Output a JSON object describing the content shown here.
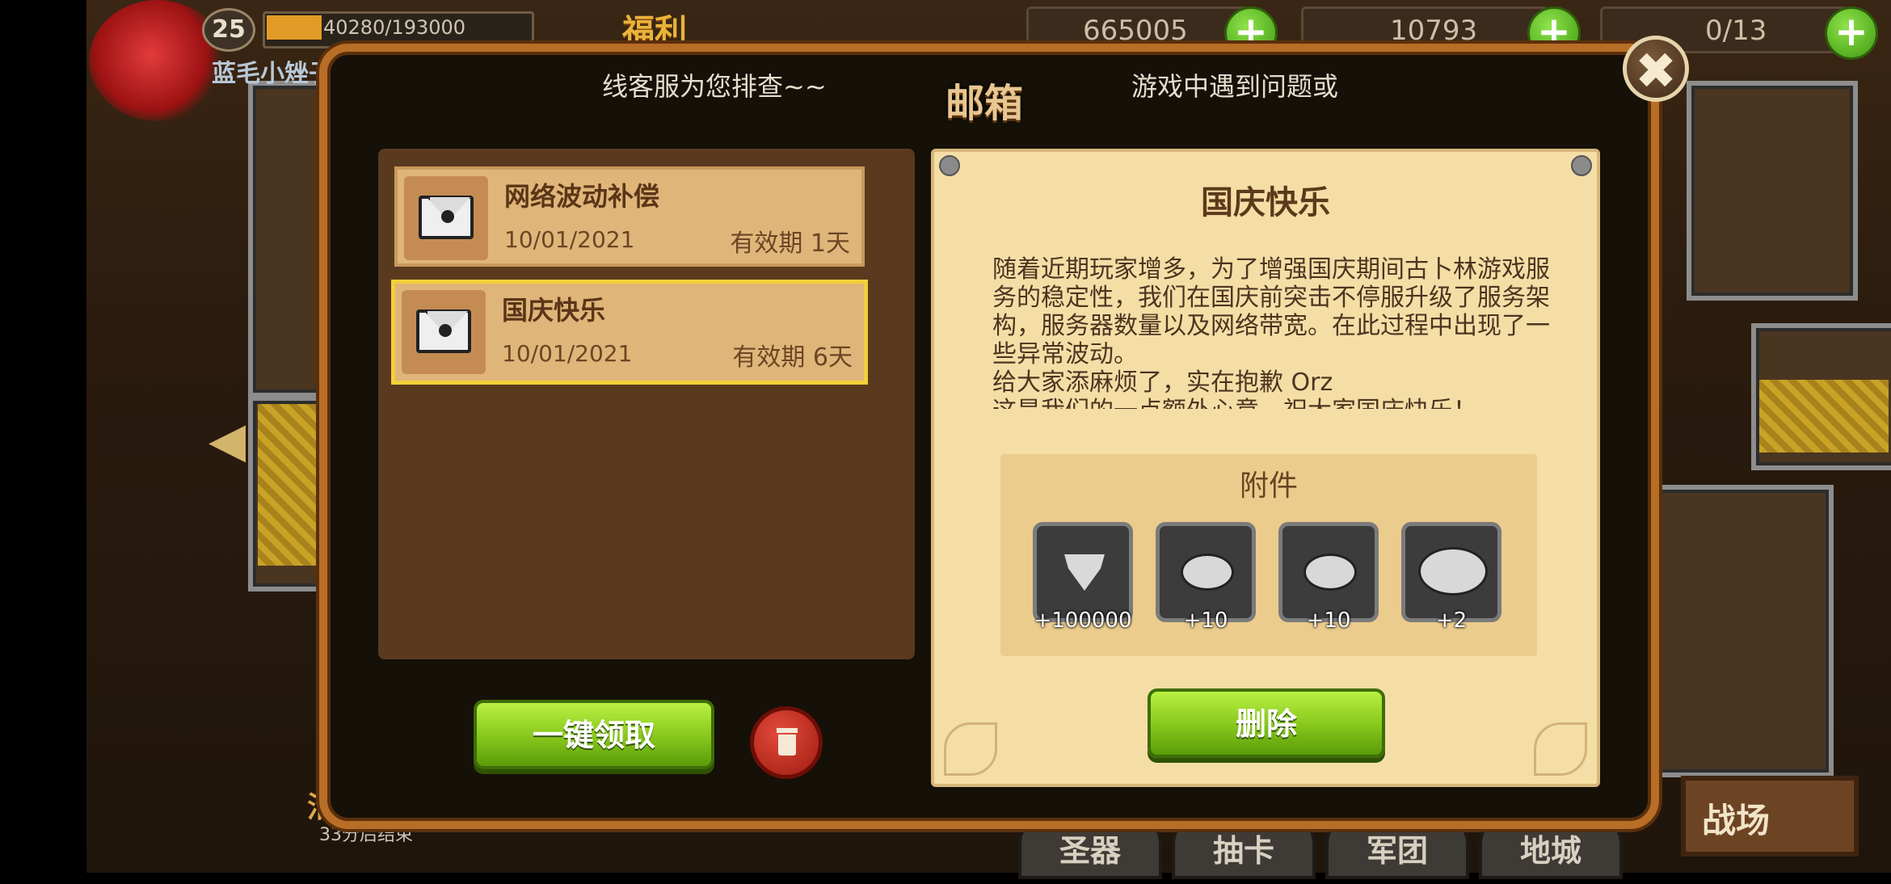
{
  "hud": {
    "level": "25",
    "xp": "40280/193000",
    "fuli": "福利",
    "player_name": "蓝毛小矬子",
    "resources": [
      {
        "icon": "gem-shield-icon",
        "value": "665005"
      },
      {
        "icon": "purple-gem-icon",
        "value": "10793"
      },
      {
        "icon": "goblin-head-icon",
        "value": "0/13"
      }
    ],
    "plus": "+",
    "event_label": "活动开始",
    "countdown": "33分后结束",
    "nav": [
      "圣器",
      "抽卡",
      "军团",
      "地城"
    ],
    "battle": "战场"
  },
  "dialog": {
    "title": "邮箱",
    "marquee_left": "线客服为您排查~~",
    "marquee_right": "游戏中遇到问题或",
    "close": "✖",
    "mails": [
      {
        "title": "网络波动补偿",
        "date": "10/01/2021",
        "expiry": "有效期  1天",
        "selected": false
      },
      {
        "title": "国庆快乐",
        "date": "10/01/2021",
        "expiry": "有效期  6天",
        "selected": true
      }
    ],
    "claim_all": "一键领取",
    "detail": {
      "title": "国庆快乐",
      "body": "随着近期玩家增多，为了增强国庆期间古卜林游戏服务的稳定性，我们在国庆前突击不停服升级了服务架构，服务器数量以及网络带宽。在此过程中出现了一些异常波动。\n给大家添麻烦了，实在抱歉 Orz\n这是我们的一点额外心意，祝大家国庆快乐！",
      "attachments_label": "附件",
      "attachments": [
        {
          "icon": "shield-currency-icon",
          "qty": "+100000"
        },
        {
          "icon": "small-pig-icon",
          "qty": "+10"
        },
        {
          "icon": "boar-icon",
          "qty": "+10"
        },
        {
          "icon": "big-boar-icon",
          "qty": "+2"
        }
      ],
      "delete": "删除"
    }
  }
}
